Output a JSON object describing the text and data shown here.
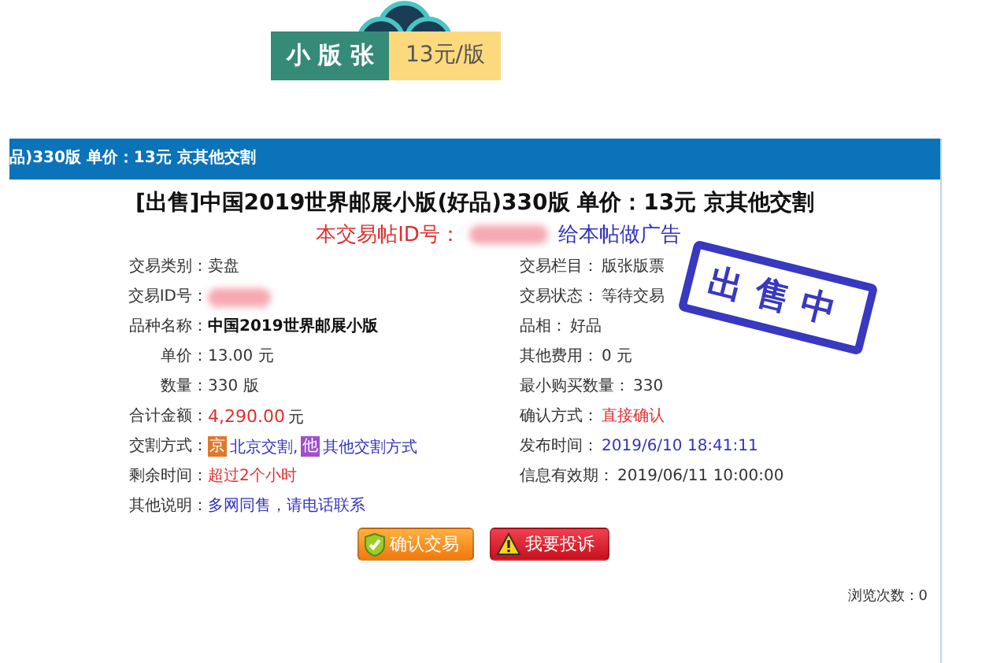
{
  "header": {
    "label": "小 版 张",
    "price": "13元/版"
  },
  "listing": {
    "bar_title": "品)330版 单价：13元 京其他交割",
    "title": "[出售]中国2019世界邮展小版(好品)330版 单价：13元 京其他交割",
    "id_label": "本交易帖ID号：",
    "ad_link": "给本帖做广告",
    "left_fields": [
      {
        "label": "交易类别：",
        "kind": "plain",
        "value": "卖盘"
      },
      {
        "label": "交易ID号：",
        "kind": "redacted"
      },
      {
        "label": "品种名称：",
        "kind": "bold",
        "value": "中国2019世界邮展小版"
      },
      {
        "label": "单价：",
        "kind": "plain",
        "value": "13.00 元"
      },
      {
        "label": "数量：",
        "kind": "plain",
        "value": "330 版"
      },
      {
        "label": "合计金额：",
        "kind": "price",
        "value": "4,290.00",
        "unit": "元"
      },
      {
        "label": "交割方式：",
        "kind": "methods",
        "methods": [
          {
            "badge": "京",
            "text": "北京交割,",
            "color": "#e0782a"
          },
          {
            "badge": "他",
            "text": "其他交割方式",
            "color": "#a050c8"
          }
        ]
      },
      {
        "label": "剩余时间：",
        "kind": "alert",
        "value": "超过2个小时"
      },
      {
        "label": "其他说明：",
        "kind": "link",
        "value": "多网同售，请电话联系"
      }
    ],
    "right_fields": [
      {
        "label": "交易栏目：",
        "kind": "plain",
        "value": "版张版票"
      },
      {
        "label": "交易状态：",
        "kind": "plain",
        "value": "等待交易"
      },
      {
        "label": "品相：",
        "kind": "plain",
        "value": "好品"
      },
      {
        "label": "其他费用：",
        "kind": "plain",
        "value": "0 元"
      },
      {
        "label": "最小购买数量：",
        "kind": "plain",
        "value": "330"
      },
      {
        "label": "确认方式：",
        "kind": "alert",
        "value": "直接确认"
      },
      {
        "label": "发布时间：",
        "kind": "link",
        "value": "2019/6/10 18:41:11"
      },
      {
        "label": "信息有效期：",
        "kind": "plain",
        "value": "2019/06/11 10:00:00"
      }
    ],
    "stamp": "出售中",
    "buttons": [
      {
        "label": "确认交易",
        "kind": "confirm"
      },
      {
        "label": "我要投诉",
        "kind": "report"
      }
    ],
    "views": "浏览次数：0"
  }
}
